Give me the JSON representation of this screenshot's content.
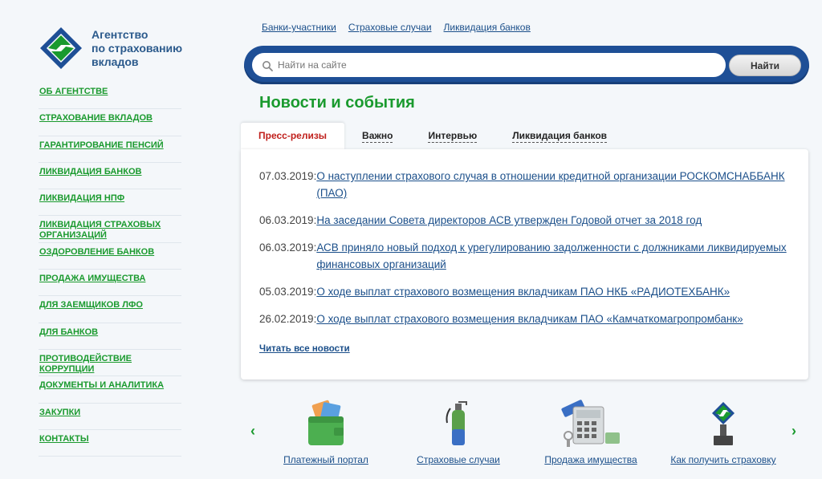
{
  "logo": {
    "text_line1": "Агентство",
    "text_line2": "по страхованию",
    "text_line3": "вкладов"
  },
  "sidebar": {
    "items": [
      {
        "line1": "Об агентстве",
        "line2": ""
      },
      {
        "line1": "Страхование вкладов",
        "line2": ""
      },
      {
        "line1": "Гарантирование пенсий",
        "line2": ""
      },
      {
        "line1": "Ликвидация банков",
        "line2": ""
      },
      {
        "line1": "Ликвидация НПФ",
        "line2": ""
      },
      {
        "line1": "Ликвидация страховых",
        "line2": "организаций"
      },
      {
        "line1": "Оздоровление банков",
        "line2": ""
      },
      {
        "line1": "Продажа имущества",
        "line2": ""
      },
      {
        "line1": "Для заемщиков ЛФО",
        "line2": ""
      },
      {
        "line1": "Для банков",
        "line2": ""
      },
      {
        "line1": "Противодействие",
        "line2": "коррупции"
      },
      {
        "line1": "Документы и аналитика",
        "line2": ""
      },
      {
        "line1": "Закупки",
        "line2": ""
      },
      {
        "line1": "Контакты",
        "line2": ""
      }
    ]
  },
  "toplinks": [
    "Банки-участники",
    "Страховые случаи",
    "Ликвидация банков"
  ],
  "search": {
    "placeholder": "Найти на сайте",
    "button_label": "Найти"
  },
  "news": {
    "heading": "Новости и события",
    "tabs": [
      "Пресс-релизы",
      "Важно",
      "Интервью",
      "Ликвидация банков"
    ],
    "active_tab": 0,
    "items": [
      {
        "date": "07.03.2019:",
        "title": "О наступлении страхового случая в отношении кредитной организации РОСКОМСНАББАНК (ПАО)"
      },
      {
        "date": "06.03.2019:",
        "title": "На заседании Совета директоров АСВ утвержден Годовой отчет за 2018 год"
      },
      {
        "date": "06.03.2019:",
        "title": "АСВ приняло новый подход к урегулированию задолженности с должниками ликвидируемых финансовых организаций"
      },
      {
        "date": "05.03.2019:",
        "title": "О ходе выплат страхового возмещения вкладчикам ПАО НКБ «РАДИОТЕХБАНК»"
      },
      {
        "date": "26.02.2019:",
        "title": "О ходе выплат страхового возмещения вкладчикам ПАО «Камчаткомагропромбанк»"
      }
    ],
    "all_news_label": "Читать все новости"
  },
  "carousel": {
    "items": [
      {
        "label": "Платежный портал",
        "icon": "wallet-icon"
      },
      {
        "label": "Страховые случаи",
        "icon": "fire-extinguisher-icon"
      },
      {
        "label": "Продажа имущества",
        "icon": "calculator-icon"
      },
      {
        "label": "Как получить страховку",
        "icon": "asv-award-icon"
      }
    ],
    "prev_arrow": "‹",
    "next_arrow": "›"
  },
  "colors": {
    "green": "#1a9a2e",
    "blue": "#1e4f96",
    "link": "#1b4f8a",
    "active_tab": "#c0201c"
  }
}
